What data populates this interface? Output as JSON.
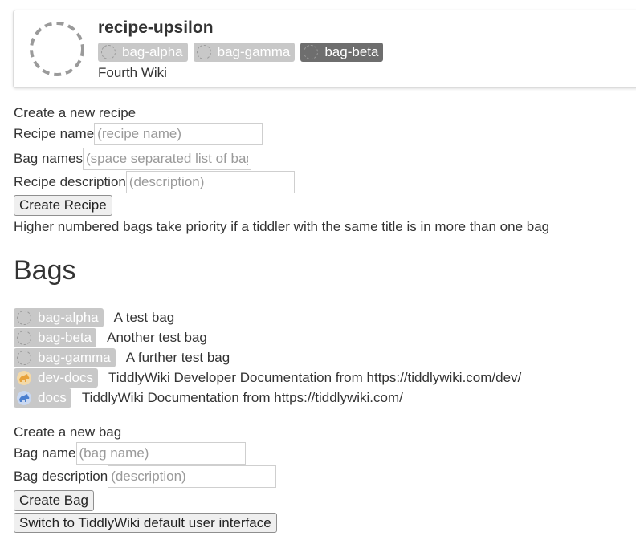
{
  "recipe": {
    "title": "recipe-upsilon",
    "bags": [
      {
        "label": "bag-alpha",
        "style": "light"
      },
      {
        "label": "bag-gamma",
        "style": "light"
      },
      {
        "label": "bag-beta",
        "style": "dark"
      }
    ],
    "description": "Fourth Wiki"
  },
  "create_recipe": {
    "heading": "Create a new recipe",
    "name_label": "Recipe name",
    "name_placeholder": "(recipe name)",
    "bags_label": "Bag names",
    "bags_placeholder": "(space separated list of bags)",
    "desc_label": "Recipe description",
    "desc_placeholder": "(description)",
    "button": "Create Recipe",
    "note": "Higher numbered bags take priority if a tiddler with the same title is in more than one bag"
  },
  "bags_section": {
    "heading": "Bags",
    "items": [
      {
        "label": "bag-alpha",
        "description": "A test bag",
        "icon": "dashed-circle-icon"
      },
      {
        "label": "bag-beta",
        "description": "Another test bag",
        "icon": "dashed-circle-icon"
      },
      {
        "label": "bag-gamma",
        "description": "A further test bag",
        "icon": "dashed-circle-icon"
      },
      {
        "label": "dev-docs",
        "description": "TiddlyWiki Developer Documentation from https://tiddlywiki.com/dev/",
        "icon": "orange-motovun-jack-icon"
      },
      {
        "label": "docs",
        "description": "TiddlyWiki Documentation from https://tiddlywiki.com/",
        "icon": "blue-motovun-jack-icon"
      }
    ]
  },
  "create_bag": {
    "heading": "Create a new bag",
    "name_label": "Bag name",
    "name_placeholder": "(bag name)",
    "desc_label": "Bag description",
    "desc_placeholder": "(description)",
    "button": "Create Bag"
  },
  "switch_button": "Switch to TiddlyWiki default user interface",
  "colors": {
    "pill_light": "#c8c8c8",
    "pill_dark": "#6e6e6e",
    "text": "#333333",
    "dev_docs_icon": "#e8a23a",
    "docs_icon": "#4a7fd0"
  }
}
